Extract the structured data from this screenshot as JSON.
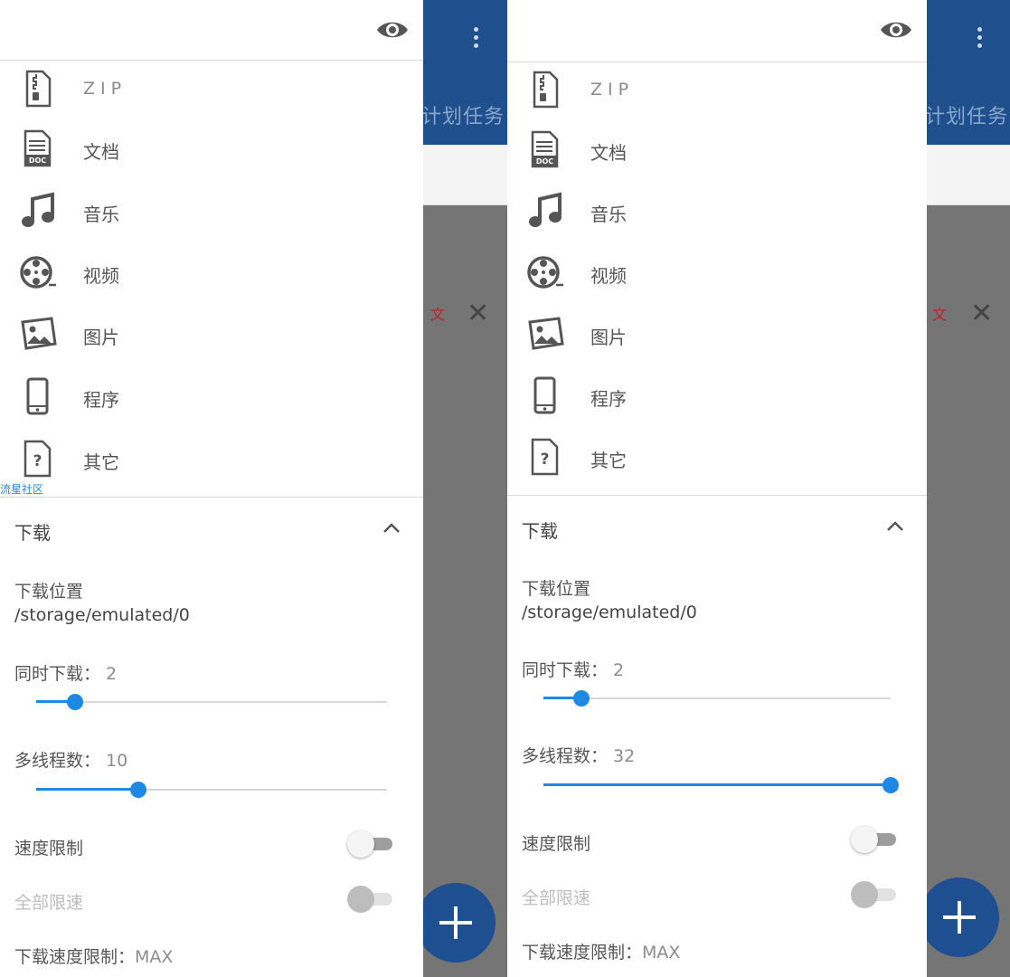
{
  "watermark": "流星社区",
  "background": {
    "title": "计划任务",
    "red_text": "文",
    "fab_icon": "plus-icon",
    "close_icon": "close-icon"
  },
  "panels": [
    {
      "categories": [
        {
          "label": "ZIP",
          "icon": "zip-file-icon"
        },
        {
          "label": "文档",
          "icon": "doc-file-icon"
        },
        {
          "label": "音乐",
          "icon": "music-note-icon"
        },
        {
          "label": "视频",
          "icon": "film-reel-icon"
        },
        {
          "label": "图片",
          "icon": "image-icon"
        },
        {
          "label": "程序",
          "icon": "phone-icon"
        },
        {
          "label": "其它",
          "icon": "unknown-file-icon"
        }
      ],
      "download": {
        "section_title": "下载",
        "location_label": "下载位置",
        "location_path": "/storage/emulated/0",
        "concurrent_label": "同时下载：",
        "concurrent_value": "2",
        "concurrent_fraction": 0.11,
        "threads_label": "多线程数：",
        "threads_value": "10",
        "threads_fraction": 0.29,
        "speed_limit_label": "速度限制",
        "speed_limit_on": false,
        "all_limit_label": "全部限速",
        "all_limit_enabled": false,
        "download_limit_label": "下载速度限制：",
        "download_limit_value": "MAX"
      }
    },
    {
      "categories": [
        {
          "label": "ZIP",
          "icon": "zip-file-icon"
        },
        {
          "label": "文档",
          "icon": "doc-file-icon"
        },
        {
          "label": "音乐",
          "icon": "music-note-icon"
        },
        {
          "label": "视频",
          "icon": "film-reel-icon"
        },
        {
          "label": "图片",
          "icon": "image-icon"
        },
        {
          "label": "程序",
          "icon": "phone-icon"
        },
        {
          "label": "其它",
          "icon": "unknown-file-icon"
        }
      ],
      "download": {
        "section_title": "下载",
        "location_label": "下载位置",
        "location_path": "/storage/emulated/0",
        "concurrent_label": "同时下载：",
        "concurrent_value": "2",
        "concurrent_fraction": 0.11,
        "threads_label": "多线程数：",
        "threads_value": "32",
        "threads_fraction": 1.0,
        "speed_limit_label": "速度限制",
        "speed_limit_on": false,
        "all_limit_label": "全部限速",
        "all_limit_enabled": false,
        "download_limit_label": "下载速度限制：",
        "download_limit_value": "MAX"
      }
    }
  ]
}
